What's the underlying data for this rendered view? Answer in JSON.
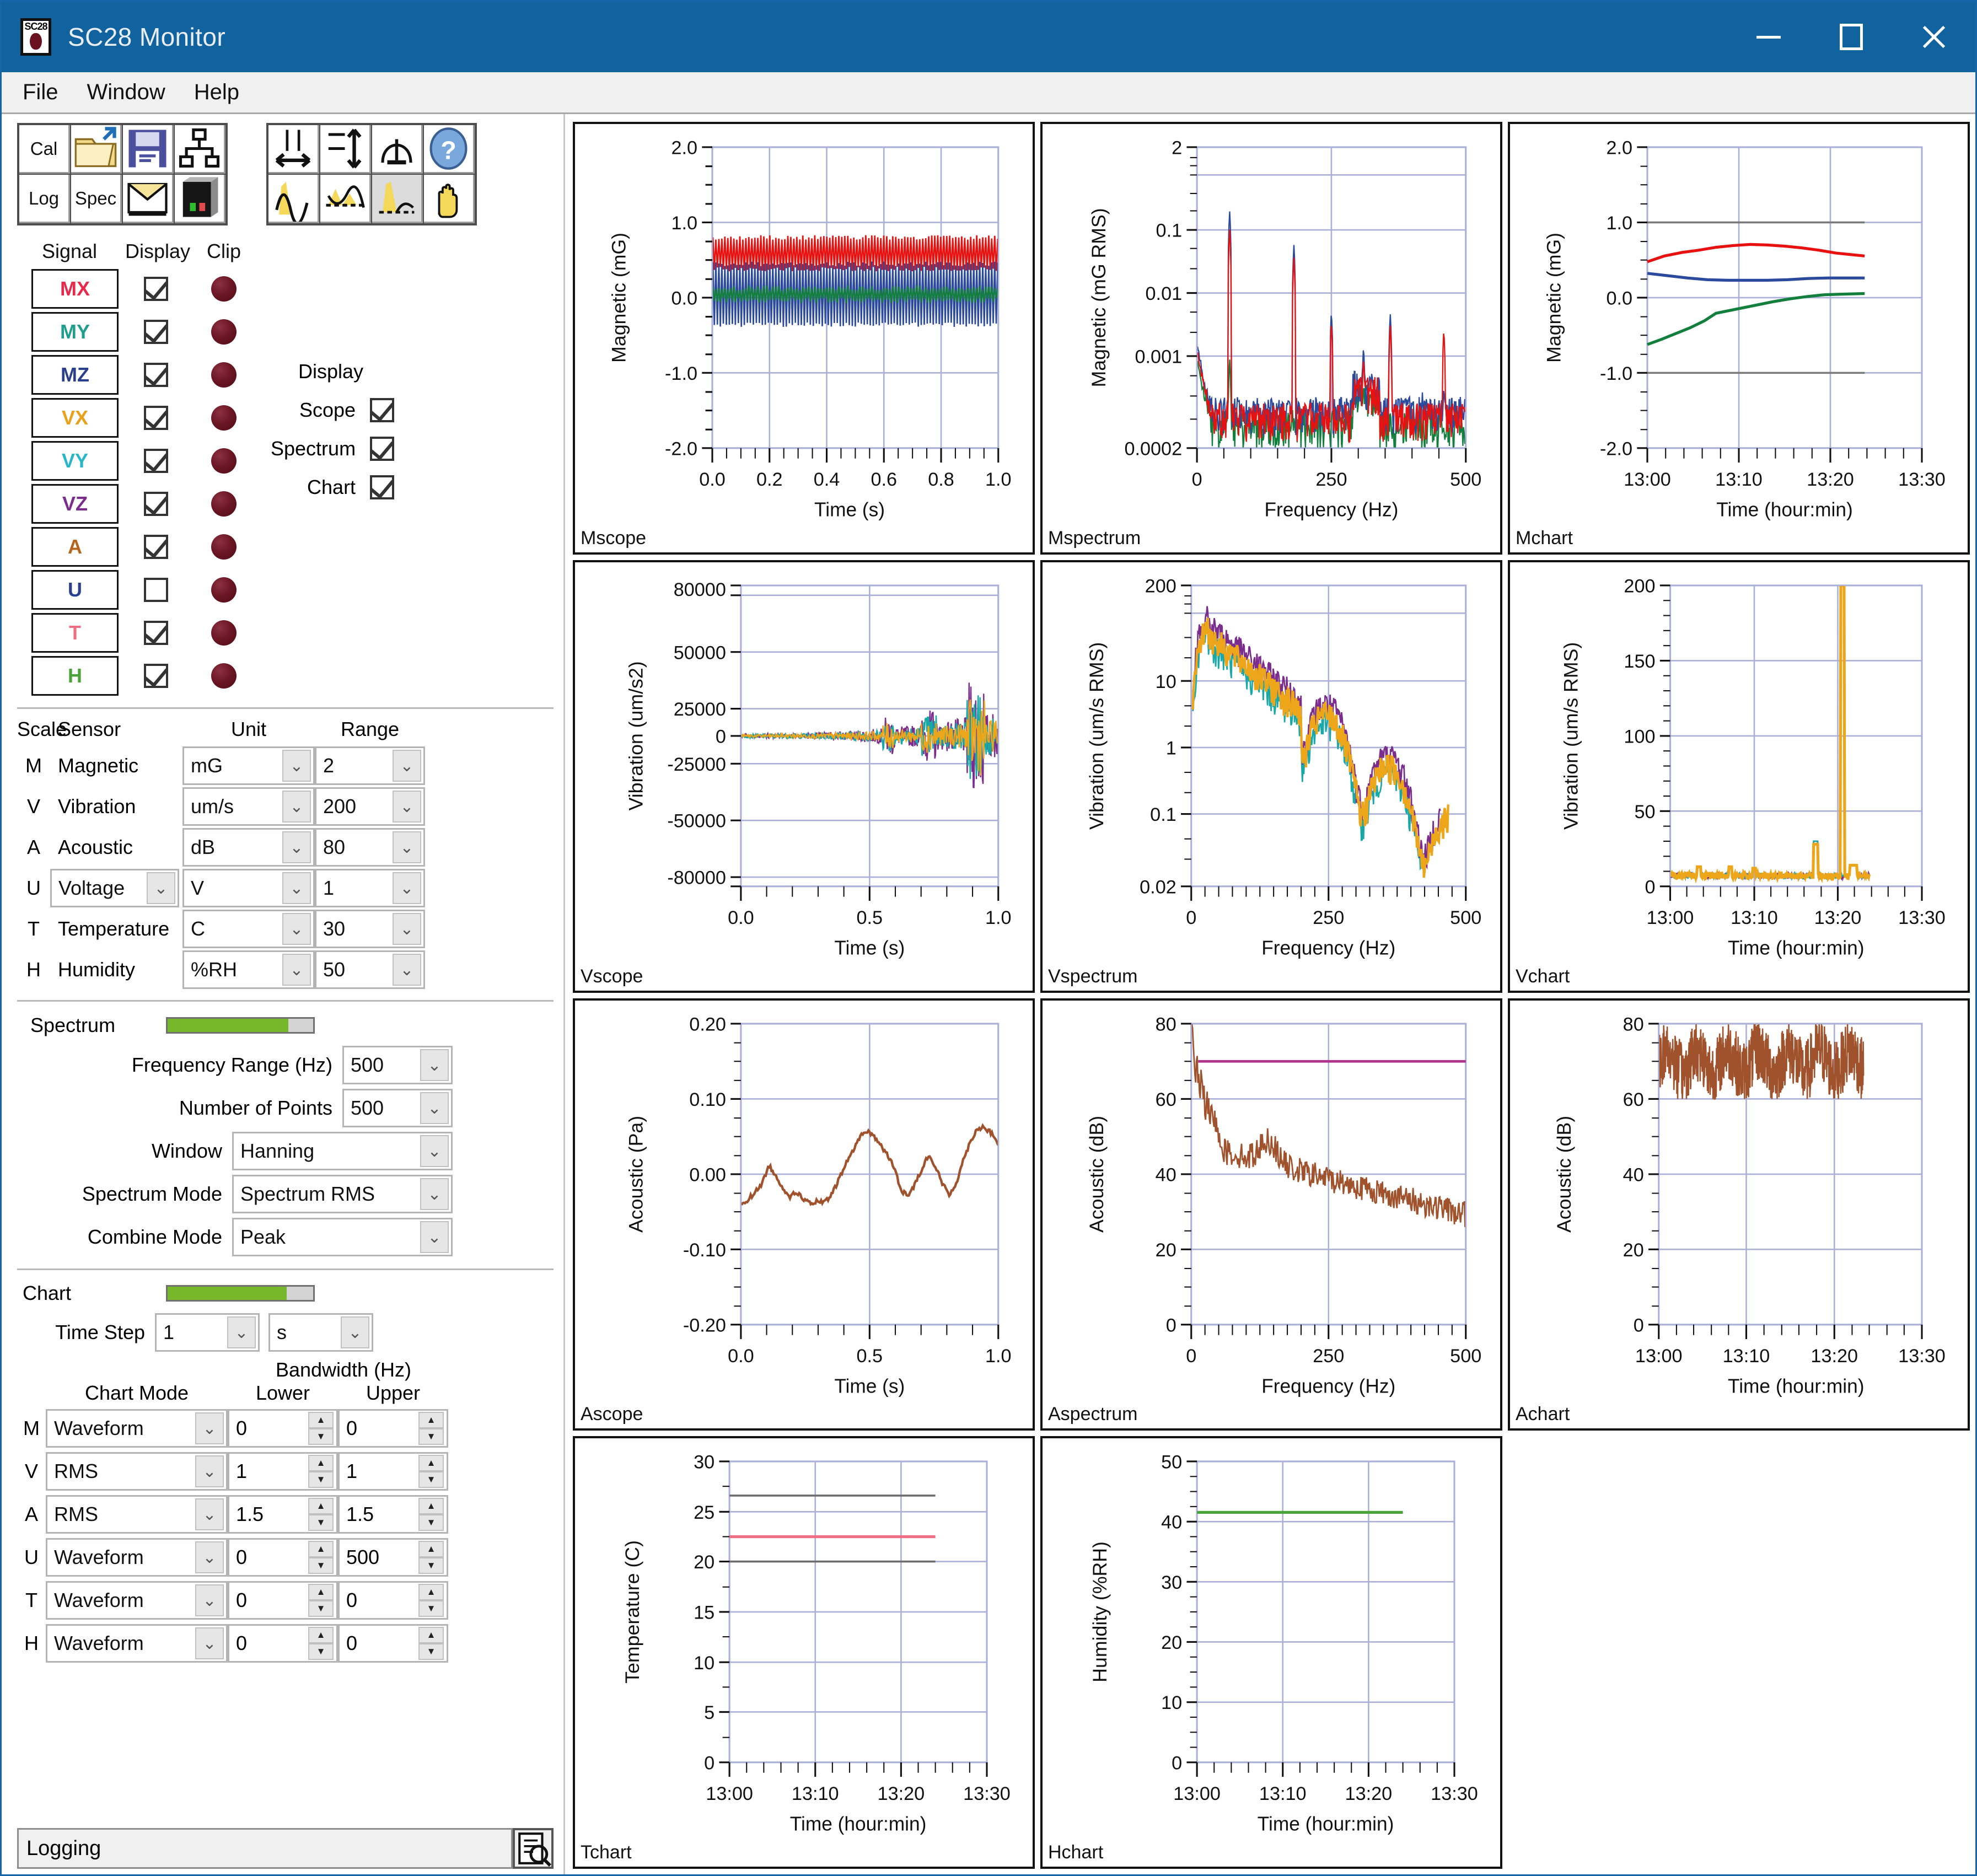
{
  "window": {
    "title": "SC28 Monitor",
    "icon_label": "SC28",
    "controls": {
      "minimize": "minimize",
      "maximize": "maximize",
      "close": "close"
    }
  },
  "menu": {
    "items": [
      "File",
      "Window",
      "Help"
    ]
  },
  "toolbar": {
    "group1": [
      {
        "label": "Cal",
        "icon": "cal-text-icon"
      },
      {
        "label": "",
        "icon": "open-folder-icon"
      },
      {
        "label": "",
        "icon": "save-disk-icon"
      },
      {
        "label": "",
        "icon": "network-icon"
      },
      {
        "label": "Log",
        "icon": "log-text-icon"
      },
      {
        "label": "Spec",
        "icon": "spec-text-icon"
      },
      {
        "label": "",
        "icon": "mail-icon"
      },
      {
        "label": "",
        "icon": "device-icon"
      }
    ],
    "group2": [
      {
        "label": "",
        "icon": "zoom-horizontal-icon"
      },
      {
        "label": "",
        "icon": "zoom-vertical-icon"
      },
      {
        "label": "",
        "icon": "cursor-drop-icon"
      },
      {
        "label": "",
        "icon": "help-globe-icon"
      },
      {
        "label": "",
        "icon": "waveform-peak-icon"
      },
      {
        "label": "",
        "icon": "waveform-band-icon"
      },
      {
        "label": "",
        "icon": "waveform-select-icon",
        "pressed": true
      },
      {
        "label": "",
        "icon": "pan-hand-icon"
      }
    ]
  },
  "signal_table": {
    "headers": {
      "signal": "Signal",
      "display": "Display",
      "clip": "Clip"
    },
    "rows": [
      {
        "label": "MX",
        "color": "#e8294a",
        "display": true
      },
      {
        "label": "MY",
        "color": "#1f9e90",
        "display": true
      },
      {
        "label": "MZ",
        "color": "#2b3f8f",
        "display": true
      },
      {
        "label": "VX",
        "color": "#e8a119",
        "display": true
      },
      {
        "label": "VY",
        "color": "#29b6c8",
        "display": true
      },
      {
        "label": "VZ",
        "color": "#7b2d8e",
        "display": true
      },
      {
        "label": "A",
        "color": "#b5651d",
        "display": true
      },
      {
        "label": "U",
        "color": "#2b3f8f",
        "display": false
      },
      {
        "label": "T",
        "color": "#ef6e84",
        "display": true
      },
      {
        "label": "H",
        "color": "#49a338",
        "display": true
      }
    ]
  },
  "display_group": {
    "title": "Display",
    "options": [
      {
        "label": "Scope",
        "checked": true
      },
      {
        "label": "Spectrum",
        "checked": true
      },
      {
        "label": "Chart",
        "checked": true
      }
    ]
  },
  "scale_table": {
    "headers": {
      "scale": "Scale",
      "sensor": "Sensor",
      "unit": "Unit",
      "range": "Range"
    },
    "rows": [
      {
        "key": "M",
        "sensor": "Magnetic",
        "sensor_combo": false,
        "unit": "mG",
        "range": "2"
      },
      {
        "key": "V",
        "sensor": "Vibration",
        "sensor_combo": false,
        "unit": "um/s",
        "range": "200"
      },
      {
        "key": "A",
        "sensor": "Acoustic",
        "sensor_combo": false,
        "unit": "dB",
        "range": "80"
      },
      {
        "key": "U",
        "sensor": "Voltage",
        "sensor_combo": true,
        "unit": "V",
        "range": "1"
      },
      {
        "key": "T",
        "sensor": "Temperature",
        "sensor_combo": false,
        "unit": "C",
        "range": "30"
      },
      {
        "key": "H",
        "sensor": "Humidity",
        "sensor_combo": false,
        "unit": "%RH",
        "range": "50"
      }
    ]
  },
  "spectrum": {
    "title": "Spectrum",
    "progress_percent": 83,
    "progress_color": "#76b82a",
    "fields": [
      {
        "label": "Frequency Range (Hz)",
        "value": "500"
      },
      {
        "label": "Number of Points",
        "value": "500"
      },
      {
        "label": "Window",
        "value": "Hanning"
      },
      {
        "label": "Spectrum Mode",
        "value": "Spectrum RMS"
      },
      {
        "label": "Combine Mode",
        "value": "Peak"
      }
    ]
  },
  "chart": {
    "title": "Chart",
    "progress_percent": 82,
    "progress_color": "#76b82a",
    "time_step_label": "Time Step",
    "time_step_value": "1",
    "time_step_unit": "s",
    "bandwidth_title": "Bandwidth (Hz)",
    "headers": {
      "mode": "Chart Mode",
      "lower": "Lower",
      "upper": "Upper"
    },
    "rows": [
      {
        "key": "M",
        "mode": "Waveform",
        "lower": "0",
        "upper": "0"
      },
      {
        "key": "V",
        "mode": "RMS",
        "lower": "1",
        "upper": "1"
      },
      {
        "key": "A",
        "mode": "RMS",
        "lower": "1.5",
        "upper": "1.5"
      },
      {
        "key": "U",
        "mode": "Waveform",
        "lower": "0",
        "upper": "500"
      },
      {
        "key": "T",
        "mode": "Waveform",
        "lower": "0",
        "upper": "0"
      },
      {
        "key": "H",
        "mode": "Waveform",
        "lower": "0",
        "upper": "0"
      }
    ]
  },
  "status": {
    "text": "Logging",
    "button_icon": "log-viewer-icon"
  },
  "chart_data": [
    {
      "name": "Mscope",
      "type": "line",
      "title": "",
      "xlabel": "Time (s)",
      "ylabel": "Magnetic (mG)",
      "xlim": [
        0,
        1
      ],
      "ylim": [
        -2.0,
        2.0
      ],
      "grid": true,
      "xticks": [
        "0.0",
        "0.2",
        "0.4",
        "0.6",
        "0.8",
        "1.0"
      ],
      "yticks": [
        "-2.0",
        "-1.0",
        "0.0",
        "1.0",
        "2.0"
      ],
      "series": [
        {
          "name": "MX",
          "color": "#e8110f",
          "note": "oscillating band 0.35..0.82 mG, ~60 Hz ripple"
        },
        {
          "name": "MZ",
          "color": "#2b4a9e",
          "note": "oscillating band -0.38..0.45 mG"
        },
        {
          "name": "MY",
          "color": "#12803c",
          "note": "oscillating band -0.03..0.12 mG"
        }
      ]
    },
    {
      "name": "Mspectrum",
      "type": "line",
      "title": "",
      "xlabel": "Frequency (Hz)",
      "ylabel": "Magnetic (mG RMS)",
      "xlim": [
        0,
        500
      ],
      "ylim": [
        0.0002,
        2
      ],
      "yscale": "log",
      "grid": true,
      "xticks": [
        "0",
        "250",
        "500"
      ],
      "yticks": [
        "0.0002",
        "0.001",
        "0.01",
        "0.1",
        "2"
      ],
      "series": [
        {
          "name": "MX",
          "color": "#e8110f",
          "peaks_hz": [
            60,
            180,
            300,
            360,
            460
          ],
          "peak_values": [
            0.16,
            0.07,
            0.009,
            0.008,
            0.007
          ]
        },
        {
          "name": "MZ",
          "color": "#2b4a9e",
          "peaks_hz": [
            60,
            180,
            250,
            360
          ],
          "peak_values": [
            0.28,
            0.1,
            0.013,
            0.012
          ]
        },
        {
          "name": "MY",
          "color": "#12803c",
          "peaks_hz": [
            60
          ],
          "peak_values": [
            0.003
          ]
        }
      ]
    },
    {
      "name": "Mchart",
      "type": "line",
      "title": "",
      "xlabel": "Time (hour:min)",
      "ylabel": "Magnetic (mG)",
      "xlim": [
        "13:00",
        "13:30"
      ],
      "ylim": [
        -2.0,
        2.0
      ],
      "grid": true,
      "xticks": [
        "13:00",
        "13:10",
        "13:20",
        "13:30"
      ],
      "yticks": [
        "-2.0",
        "-1.0",
        "0.0",
        "1.0",
        "2.0"
      ],
      "series": [
        {
          "name": "MX",
          "color": "#e8110f",
          "values": [
            0.48,
            0.56,
            0.62,
            0.66,
            0.68,
            0.67,
            0.64,
            0.6,
            0.58
          ]
        },
        {
          "name": "MZ",
          "color": "#2b4a9e",
          "values": [
            0.32,
            0.29,
            0.26,
            0.25,
            0.25,
            0.26,
            0.27,
            0.27,
            0.27
          ]
        },
        {
          "name": "MY",
          "color": "#12803c",
          "values": [
            -0.62,
            -0.48,
            -0.35,
            -0.22,
            -0.13,
            -0.07,
            -0.03,
            0.01,
            0.03
          ]
        }
      ]
    },
    {
      "name": "Vscope",
      "type": "line",
      "title": "",
      "xlabel": "Time (s)",
      "ylabel": "Vibration (um/s2)",
      "xlim": [
        0,
        1
      ],
      "ylim": [
        -80000,
        80000
      ],
      "grid": true,
      "xticks": [
        "0.0",
        "0.5",
        "1.0"
      ],
      "yticks": [
        "-80000",
        "-50000",
        "-25000",
        "0",
        "25000",
        "50000",
        "80000"
      ],
      "series": [
        {
          "name": "VX",
          "color": "#eda519",
          "note": "noise band growing from ±1500 to ±9000"
        },
        {
          "name": "VY",
          "color": "#19a8a8",
          "note": "noise band growing to ±12000"
        },
        {
          "name": "VZ",
          "color": "#7b2d8e",
          "note": "noise band with spike to 27000 near t=0.92"
        }
      ]
    },
    {
      "name": "Vspectrum",
      "type": "line",
      "title": "",
      "xlabel": "Frequency (Hz)",
      "ylabel": "Vibration (um/s RMS)",
      "xlim": [
        0,
        500
      ],
      "ylim": [
        0.02,
        200
      ],
      "yscale": "log",
      "grid": true,
      "xticks": [
        "0",
        "250",
        "500"
      ],
      "yticks": [
        "0.02",
        "0.1",
        "1",
        "10",
        "200"
      ],
      "series": [
        {
          "name": "VX",
          "color": "#eda519",
          "note": "falls from ~60 at 20Hz to ~0.05 at 450Hz"
        },
        {
          "name": "VY",
          "color": "#19a8a8",
          "note": "falls from ~50 to ~0.02 at 420Hz"
        },
        {
          "name": "VZ",
          "color": "#7b2d8e",
          "note": "falls from ~100 at 25Hz to ~0.02 at 450Hz"
        }
      ]
    },
    {
      "name": "Vchart",
      "type": "line",
      "title": "",
      "xlabel": "Time (hour:min)",
      "ylabel": "Vibration (um/s RMS)",
      "xlim": [
        "13:00",
        "13:30"
      ],
      "ylim": [
        0,
        200
      ],
      "grid": true,
      "xticks": [
        "13:00",
        "13:10",
        "13:20",
        "13:30"
      ],
      "yticks": [
        "0",
        "50",
        "100",
        "150",
        "200"
      ],
      "series": [
        {
          "name": "VX",
          "color": "#eda519",
          "note": "baseline ~6, bump 26 at 13:18, spike to 200 at 13:22"
        },
        {
          "name": "VY",
          "color": "#19a8a8",
          "note": "baseline ~6, bump 30 at 13:18"
        },
        {
          "name": "VZ",
          "color": "#7b2d8e",
          "note": "baseline ~7, bumps to 14"
        }
      ]
    },
    {
      "name": "Ascope",
      "type": "line",
      "title": "",
      "xlabel": "Time (s)",
      "ylabel": "Acoustic (Pa)",
      "xlim": [
        0,
        1
      ],
      "ylim": [
        -0.2,
        0.2
      ],
      "grid": true,
      "xticks": [
        "0.0",
        "0.5",
        "1.0"
      ],
      "yticks": [
        "-0.20",
        "-0.10",
        "0.00",
        "0.10",
        "0.20"
      ],
      "series": [
        {
          "name": "A",
          "color": "#a0522d",
          "values": [
            -0.042,
            -0.03,
            -0.018,
            0.014,
            -0.006,
            -0.034,
            -0.022,
            -0.03,
            -0.04,
            -0.038,
            -0.01,
            0.02,
            0.045,
            0.058,
            0.04,
            0.02,
            -0.022,
            -0.01,
            0.03,
            0.01,
            -0.025,
            0.006,
            0.048,
            0.065,
            0.04
          ]
        }
      ]
    },
    {
      "name": "Aspectrum",
      "type": "line",
      "title": "",
      "xlabel": "Frequency (Hz)",
      "ylabel": "Acoustic (dB)",
      "xlim": [
        0,
        500
      ],
      "ylim": [
        0,
        80
      ],
      "grid": true,
      "xticks": [
        "0",
        "250",
        "500"
      ],
      "yticks": [
        "0",
        "20",
        "40",
        "60",
        "80"
      ],
      "series": [
        {
          "name": "A",
          "color": "#a0522d",
          "note": "80 dB at DC falling to ~28 dB at 500 Hz, peak 52 dB at 140 Hz"
        },
        {
          "name": "A limit",
          "color": "#b0338c",
          "type": "hline",
          "value": 70
        }
      ]
    },
    {
      "name": "Achart",
      "type": "line",
      "title": "",
      "xlabel": "Time (hour:min)",
      "ylabel": "Acoustic (dB)",
      "xlim": [
        "13:00",
        "13:30"
      ],
      "ylim": [
        0,
        80
      ],
      "grid": true,
      "xticks": [
        "13:00",
        "13:10",
        "13:20",
        "13:30"
      ],
      "yticks": [
        "0",
        "20",
        "40",
        "60",
        "80"
      ],
      "series": [
        {
          "name": "A",
          "color": "#a0522d",
          "note": "dense noise band 61..80 dB, mean ~70 dB"
        }
      ]
    },
    {
      "name": "Tchart",
      "type": "line",
      "title": "",
      "xlabel": "Time (hour:min)",
      "ylabel": "Temperature (C)",
      "xlim": [
        "13:00",
        "13:30"
      ],
      "ylim": [
        0,
        30
      ],
      "grid": true,
      "xticks": [
        "13:00",
        "13:10",
        "13:20",
        "13:30"
      ],
      "yticks": [
        "0",
        "5",
        "10",
        "15",
        "20",
        "25",
        "30"
      ],
      "series": [
        {
          "name": "T",
          "color": "#ef6e84",
          "value": 22.5,
          "note": "flat line at 22.5 C"
        },
        {
          "name": "T upper limit",
          "color": "#555555",
          "type": "hline",
          "value": 26.5
        },
        {
          "name": "T lower limit",
          "color": "#555555",
          "type": "hline",
          "value": 20.0
        }
      ]
    },
    {
      "name": "Hchart",
      "type": "line",
      "title": "",
      "xlabel": "Time (hour:min)",
      "ylabel": "Humidity (%RH)",
      "xlim": [
        "13:00",
        "13:30"
      ],
      "ylim": [
        0,
        50
      ],
      "grid": true,
      "xticks": [
        "13:00",
        "13:10",
        "13:20",
        "13:30"
      ],
      "yticks": [
        "0",
        "10",
        "20",
        "30",
        "40",
        "50"
      ],
      "series": [
        {
          "name": "H",
          "color": "#49a338",
          "value": 41.5,
          "note": "flat line at 41.5 %RH"
        }
      ]
    }
  ]
}
